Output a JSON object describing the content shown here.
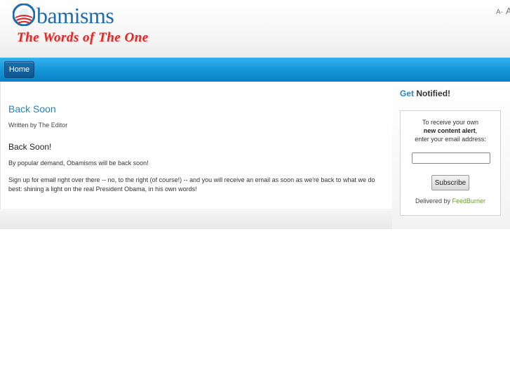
{
  "header": {
    "logo_text": "bamisms",
    "tagline": "The Words of The One",
    "font_smaller": "A-",
    "font_bigger": "A"
  },
  "nav": {
    "home_label": "Home"
  },
  "article": {
    "title": "Back Soon",
    "author": "Written by The Editor",
    "heading": "Back Soon!",
    "paragraph1": "By popular demand, Obamisms will be back soon!",
    "paragraph2": "Sign up for email right over there -- no, to the right (of course!) -- and you will receive an email as soon as we're back to what we do best:  shining a light on the real President Obama, in his own words!"
  },
  "sidebar": {
    "title_accent": "Get",
    "title_rest": "Notified!",
    "notify_line1": "To receive your own",
    "notify_bold": "new content alert",
    "notify_line3": "enter your email address:",
    "email_value": "",
    "subscribe_label": "Subscribe",
    "delivered_by": "Delivered by",
    "feedburner_link": "FeedBurner"
  },
  "colors": {
    "brand_blue": "#1f6bb0",
    "tagline_red": "#d82d2d",
    "nav_blue": "#1595d9",
    "link_green": "#6a9b2f"
  }
}
